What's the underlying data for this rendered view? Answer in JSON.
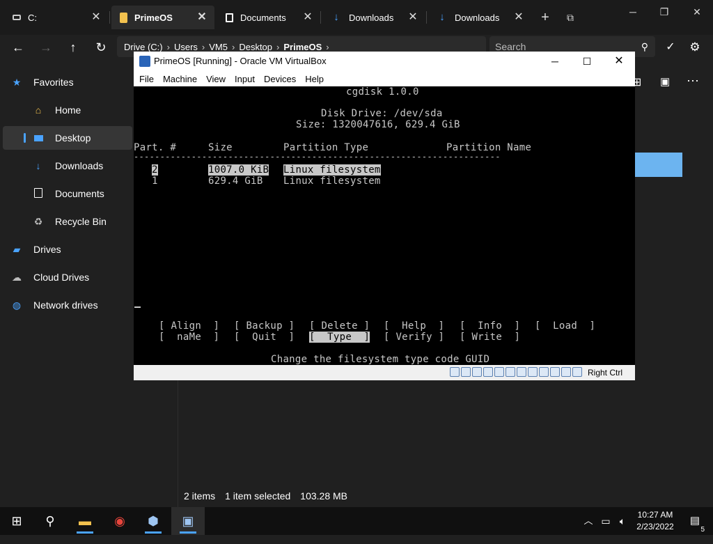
{
  "tabs": [
    {
      "label": "C:",
      "icon": "drive-icon"
    },
    {
      "label": "PrimeOS",
      "icon": "folder-icon"
    },
    {
      "label": "Documents",
      "icon": "document-icon"
    },
    {
      "label": "Downloads",
      "icon": "download-icon"
    },
    {
      "label": "Downloads",
      "icon": "download-icon"
    }
  ],
  "address": {
    "crumbs": [
      "Drive (C:)",
      "Users",
      "VM5",
      "Desktop",
      "PrimeOS"
    ],
    "search_placeholder": "Search"
  },
  "sidebar": {
    "items": [
      {
        "label": "Favorites",
        "icon": "star-icon"
      },
      {
        "label": "Home",
        "icon": "home-icon"
      },
      {
        "label": "Desktop",
        "icon": "desktop-icon"
      },
      {
        "label": "Downloads",
        "icon": "download-icon"
      },
      {
        "label": "Documents",
        "icon": "document-icon"
      },
      {
        "label": "Recycle Bin",
        "icon": "recycle-bin-icon"
      },
      {
        "label": "Drives",
        "icon": "drive-icon"
      },
      {
        "label": "Cloud Drives",
        "icon": "cloud-icon"
      },
      {
        "label": "Network drives",
        "icon": "network-icon"
      }
    ]
  },
  "status": {
    "items": "2 items",
    "selected": "1 item selected",
    "size": "103.28 MB"
  },
  "vbox": {
    "title": "PrimeOS [Running] - Oracle VM VirtualBox",
    "menu": [
      "File",
      "Machine",
      "View",
      "Input",
      "Devices",
      "Help"
    ],
    "host_key": "Right Ctrl",
    "terminal": {
      "app": "cgdisk 1.0.0",
      "disk_drive": "Disk Drive: /dev/sda",
      "size_line": "Size: 1320047616, 629.4 GiB",
      "columns": {
        "part": "Part. #",
        "size": "Size",
        "type": "Partition Type",
        "name": "Partition Name"
      },
      "divider": "----------------------------------------------------------------------",
      "rows": [
        {
          "num": "2",
          "size": "1007.0 KiB",
          "type": "Linux filesystem",
          "selected": true
        },
        {
          "num": "1",
          "size": "629.4 GiB",
          "type": "Linux filesystem",
          "selected": false
        }
      ],
      "menu_row1": [
        "[ Align  ]",
        "[ Backup ]",
        "[ Delete ]",
        "[  Help  ]",
        "[  Info  ]",
        "[  Load  ]"
      ],
      "menu_row2": [
        "[  naMe  ]",
        "[  Quit  ]",
        "[  Type  ]",
        "[ Verify ]",
        "[ Write  ]"
      ],
      "hint": "Change the filesystem type code GUID"
    }
  },
  "taskbar": {
    "time": "10:27 AM",
    "date": "2/23/2022",
    "notifications": "5"
  },
  "colors": {
    "accent": "#4aa3ff",
    "folder": "#f2c14e",
    "selection": "#6cb4f0",
    "background": "#202020"
  }
}
